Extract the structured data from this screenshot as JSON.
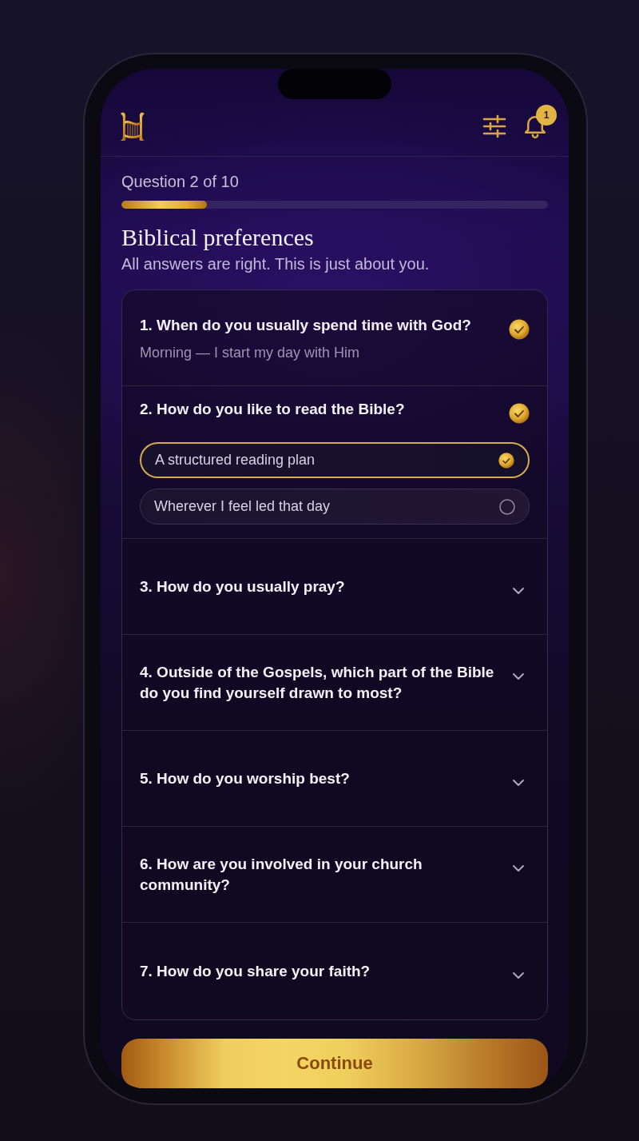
{
  "header": {
    "notification_count": "1"
  },
  "progress": {
    "label": "Question 2 of 10",
    "level": 0.2
  },
  "title": "Biblical preferences",
  "subtitle": "All answers are right. This is just about you.",
  "questions": [
    {
      "question": "1. When do you usually spend time with God?",
      "answered": true,
      "expanded": false,
      "answer": "Morning — I start my day with Him"
    },
    {
      "question": "2. How do you like to read the Bible?",
      "answered": true,
      "expanded": true,
      "options": [
        {
          "label": "A structured reading plan",
          "selected": true
        },
        {
          "label": "Wherever I feel led that day",
          "selected": false
        }
      ]
    },
    {
      "question": "3. How do you usually pray?",
      "answered": false,
      "expanded": false
    },
    {
      "question": "4. Outside of the Gospels, which part of the Bible do you find yourself drawn to most?",
      "answered": false,
      "expanded": false
    },
    {
      "question": "5. How do you worship best?",
      "answered": false,
      "expanded": false
    },
    {
      "question": "6. How are you involved in your church community?",
      "answered": false,
      "expanded": false
    },
    {
      "question": "7. How do you share your faith?",
      "answered": false,
      "expanded": false
    }
  ],
  "continue_button": "Continue"
}
